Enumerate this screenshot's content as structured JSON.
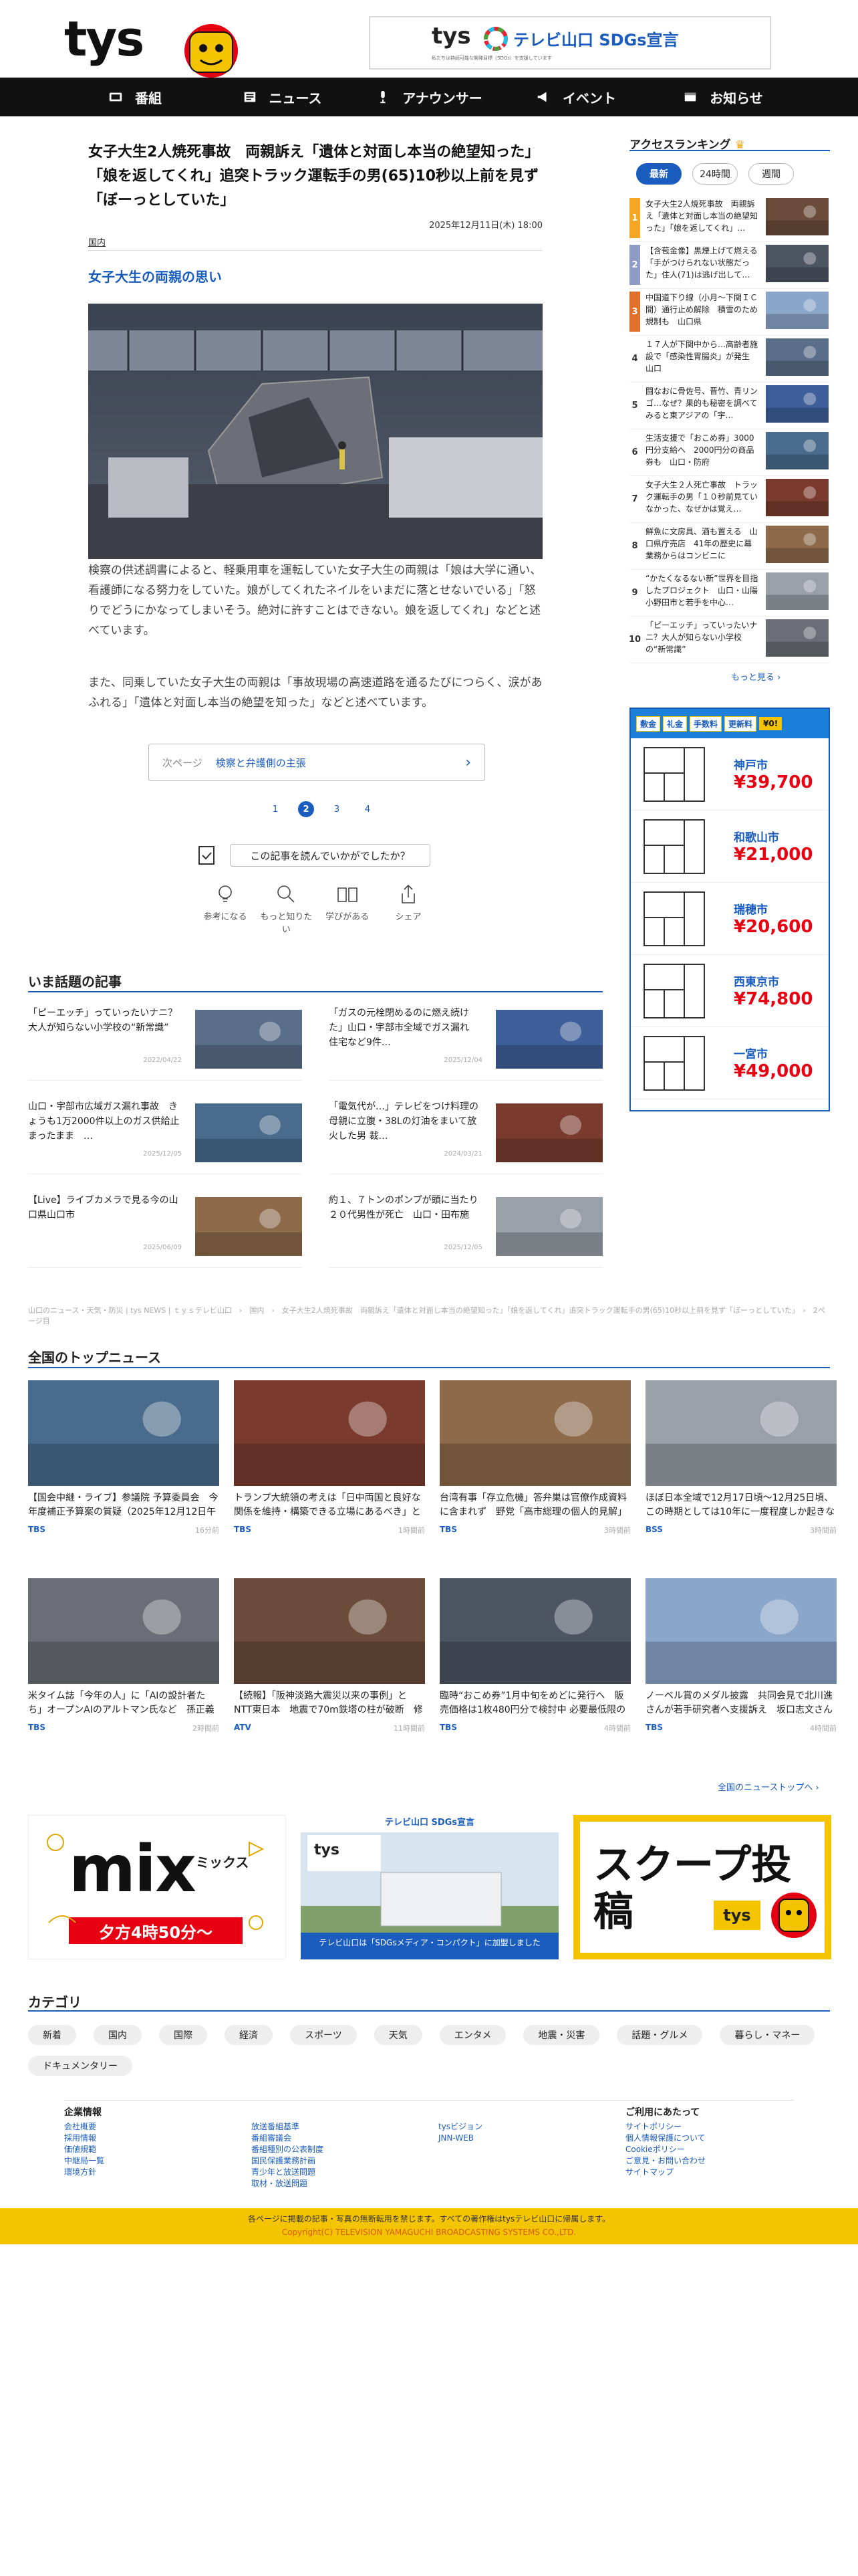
{
  "header": {
    "logo": "tys",
    "sdg_logo": "tys",
    "sdg_title": "テレビ山口 SDGs宣言",
    "sdg_sub": "私たちは持続可能な開発目標（SDGs）を支援しています"
  },
  "nav": [
    {
      "label": "番組",
      "icon": "tv-icon"
    },
    {
      "label": "ニュース",
      "icon": "news-icon"
    },
    {
      "label": "アナウンサー",
      "icon": "microphone-icon"
    },
    {
      "label": "イベント",
      "icon": "megaphone-icon"
    },
    {
      "label": "お知らせ",
      "icon": "notice-icon"
    }
  ],
  "article": {
    "title": "女子大生2人焼死事故　両親訴え「遺体と対面し本当の絶望知った」「娘を返してくれ」追突トラック運転手の男(65)10秒以上前を見ず「ぼーっとしていた」",
    "date": "2025年12月11日(木) 18:00",
    "category": "国内",
    "subhead": "女子大生の両親の思い",
    "para1": "検察の供述調書によると、軽乗用車を運転していた女子大生の両親は「娘は大学に通い、看護師になる努力をしていた。娘がしてくれたネイルをいまだに落とせないでいる」「怒りでどうにかなってしまいそう。絶対に許すことはできない。娘を返してくれ」などと述べています。",
    "para2": "また、同乗していた女子大生の両親は「事故現場の高速道路を通るたびにつらく、涙があふれる」「遺体と対面し本当の絶望を知った」などと述べています。",
    "next_label": "次ページ",
    "next_title": "検察と弁護側の主張",
    "pages": [
      "1",
      "2",
      "3",
      "4"
    ],
    "current_page": "2",
    "question": "この記事を読んでいかがでしたか？",
    "reactions": [
      {
        "label": "参考になる",
        "icon": "lightbulb-icon"
      },
      {
        "label": "もっと知りたい",
        "icon": "magnifier-icon"
      },
      {
        "label": "学びがある",
        "icon": "book-icon"
      },
      {
        "label": "シェア",
        "icon": "share-icon"
      }
    ]
  },
  "ranking": {
    "heading": "アクセスランキング",
    "tabs": [
      "最新",
      "24時間",
      "週間"
    ],
    "active_tab": "最新",
    "items": [
      {
        "rank": "1",
        "title": "女子大生2人焼死事故　両親訴え「遺体と対面し本当の絶望知った」「娘を返してくれ」…",
        "color": "#f5a623"
      },
      {
        "rank": "2",
        "title": "【含苞金像】黒煙上げて燃える「手がつけられない状態だった」住人(71)は逃げ出して…",
        "color": "#8e9bc4"
      },
      {
        "rank": "3",
        "title": "中国道下り線（小月〜下関ＩＣ間）通行止め解除　積雪のため規制も　山口県",
        "color": "#e0702a"
      },
      {
        "rank": "4",
        "title": "１７人が下関中から…高齢者施設で「感染性胃腸炎」が発生　山口",
        "color": ""
      },
      {
        "rank": "5",
        "title": "闘なおに骨佐号、晋竹、青リンゴ…なぜ？果的も秘密を調べてみると東アジアの「宇…",
        "color": ""
      },
      {
        "rank": "6",
        "title": "生活支援で「おこめ券」3000円分支給へ　2000円分の商品券も　山口・防府",
        "color": ""
      },
      {
        "rank": "7",
        "title": "女子大生２人死亡事故　トラック運転手の男「１０秒前見ていなかった、なぜかは覚え…",
        "color": ""
      },
      {
        "rank": "8",
        "title": "鮮魚に文房具、酒も置える　山口県庁売店　41年の歴史に幕　業務からはコンビニに",
        "color": ""
      },
      {
        "rank": "9",
        "title": "“かたくなるない新”世界を目指したプロジェクト　山口・山陽小野田市と若手を中心…",
        "color": ""
      },
      {
        "rank": "10",
        "title": "「ピーエッチ」っていったいナニ？大人が知らない小学校の“新常識”",
        "color": ""
      }
    ],
    "more": "もっと見る ›"
  },
  "realestate_ad": {
    "chips": [
      "敷金",
      "礼金",
      "手数料",
      "更新料",
      "¥0!"
    ],
    "listings": [
      {
        "city": "神戸市",
        "price": "¥39,700"
      },
      {
        "city": "和歌山市",
        "price": "¥21,000"
      },
      {
        "city": "瑞穂市",
        "price": "¥20,600"
      },
      {
        "city": "西東京市",
        "price": "¥74,800"
      },
      {
        "city": "一宮市",
        "price": "¥49,000"
      }
    ]
  },
  "hot_topics": {
    "heading": "いま話題の記事",
    "items": [
      {
        "title": "「ピーエッチ」っていったいナニ？大人が知らない小学校の“新常識”",
        "time": "2022/04/22"
      },
      {
        "title": "「ガスの元栓閉めるのに燃え続けた」山口・宇部市全域でガス漏れ　住宅など9件…",
        "time": "2025/12/04"
      },
      {
        "title": "山口・宇部市広域ガス漏れ事故　きょうも1万2000件以上のガス供給止まったまま　…",
        "time": "2025/12/05"
      },
      {
        "title": "「電気代が…」テレビをつけ料理の母親に立腹・38Lの灯油をまいて放火した男 裁…",
        "time": "2024/03/21"
      },
      {
        "title": "【Live】ライブカメラで見る今の山口県山口市",
        "time": "2025/06/09"
      },
      {
        "title": "約１、７トンのポンプが頭に当たり２０代男性が死亡　山口・田布施",
        "time": "2025/12/05"
      }
    ]
  },
  "breadcrumb": "山口のニュース・天気・防災 | tys NEWS | ｔｙｓテレビ山口　›　国内　›　女子大生2人焼死事故　両親訴え「遺体と対面し本当の絶望知った」「娘を返してくれ」追突トラック運転手の男(65)10秒以上前を見ず「ぼーっとしていた」　›　2ページ目",
  "national": {
    "heading": "全国のトップニュース",
    "items": [
      {
        "title": "【国会中継・ライブ】参議院 予算委員会　今年度補正予算案の質疑（2025年12月12日午前8時55分〜LIVE配信）",
        "source": "TBS",
        "time": "16分前"
      },
      {
        "title": "トランプ大統領の考えは「日中両国と良好な関係を維持・構築できる立場にあるべき」と米報道官　中国が日本…",
        "source": "TBS",
        "time": "1時間前"
      },
      {
        "title": "台湾有事「存立危機」答弁巣は官僚作成資料に含まれず　野党「高市総理の個人的見解」と指摘",
        "source": "TBS",
        "time": "3時間前"
      },
      {
        "title": "ほぼ日本全域で12月17日頃〜12月25日頃、この時期としては10年に一度程度しか起きないような著しい高温に…",
        "source": "BSS",
        "time": "3時間前"
      },
      {
        "title": "米タイム誌「今年の人」に「AIの設計者たち」オープンAIのアルトマン氏など　孫正義氏は“最も有力な伝道者”…",
        "source": "TBS",
        "time": "2時間前"
      },
      {
        "title": "【続報】「阪神淡路大震災以来の事例」とNTT東日本　地震で70m鉄塔の柱が破断　修復めど立たず避難指示は長…",
        "source": "ATV",
        "time": "11時間前"
      },
      {
        "title": "臨時“おこめ券”1月中旬をめどに発行へ　販売価格は1枚480円分で検討中 必要最低限の経費だけを加える形　JA…",
        "source": "TBS",
        "time": "4時間前"
      },
      {
        "title": "ノーベル賞のメダル披露　共同会見で北川進さんが若手研究者へ支援訴え　坂口志文さんは子どもたちへメッセ…",
        "source": "TBS",
        "time": "4時間前"
      }
    ],
    "more": "全国のニューストップへ ›"
  },
  "banners": {
    "mix_title": "mix",
    "mix_kana": "ミックス",
    "mix_time": "夕方4時50分〜",
    "sdg_label": "テレビ山口 SDGs宣言",
    "sdg_caption": "テレビ山口は「SDGsメディア・コンパクト」に加盟しました",
    "scoop_title": "スクープ投稿",
    "scoop_logo": "tys"
  },
  "categories": {
    "heading": "カテゴリ",
    "items": [
      "新着",
      "国内",
      "国際",
      "経済",
      "スポーツ",
      "天気",
      "エンタメ",
      "地震・災害",
      "話題・グルメ",
      "暮らし・マネー",
      "ドキュメンタリー"
    ]
  },
  "footer": {
    "col1_h": "企業情報",
    "col1": [
      "会社概要",
      "採用情報",
      "価値規範",
      "中継局一覧",
      "環境方針"
    ],
    "col2": [
      "放送番組基準",
      "番組審議会",
      "番組種別の公表制度",
      "国民保護業務計画",
      "青少年と放送問題",
      "取材・放送問題"
    ],
    "col3": [
      "tysビジョン",
      "JNN-WEB"
    ],
    "col4_h": "ご利用にあたって",
    "col4": [
      "サイトポリシー",
      "個人情報保護について",
      "Cookieポリシー",
      "ご意見・お問い合わせ",
      "サイトマップ"
    ],
    "notice": "各ページに掲載の記事・写真の無断転用を禁じます。すべての著作権はtysテレビ山口に帰属します。",
    "copyright": "Copyright(C) TELEVISION YAMAGUCHI BROADCASTING SYSTEMS CO.,LTD."
  },
  "colors": {
    "accent": "#1a5dbf",
    "brand_yellow": "#f5c400",
    "price": "#e60012"
  }
}
